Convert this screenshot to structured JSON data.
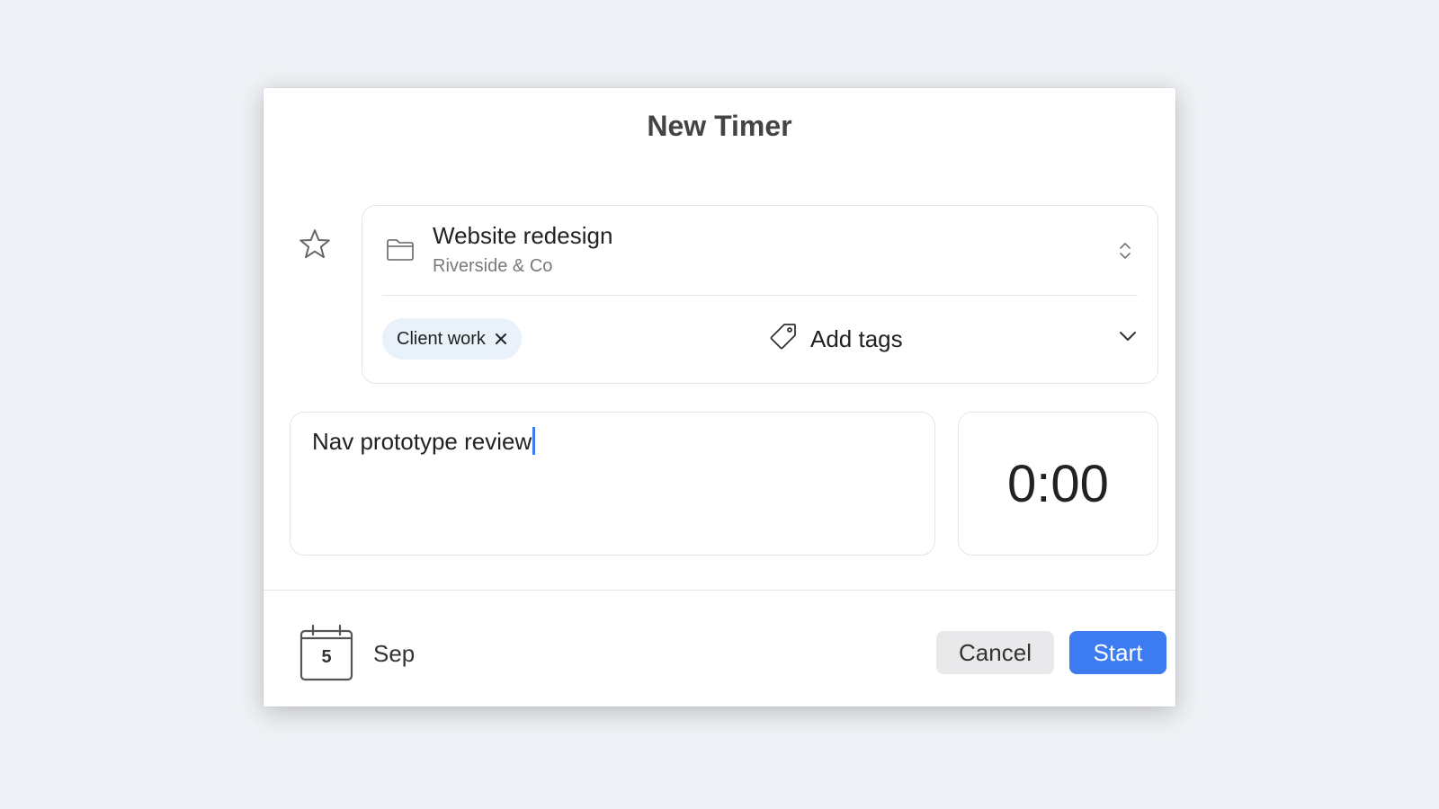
{
  "dialog": {
    "title": "New Timer"
  },
  "project": {
    "name": "Website redesign",
    "client": "Riverside & Co",
    "favorite_icon": "star-outline-icon",
    "folder_icon": "folder-icon",
    "picker_icon": "chevron-up-down-icon"
  },
  "tags": {
    "selected": [
      {
        "label": "Client work",
        "remove_icon": "close-x-icon"
      }
    ],
    "add_label": "Add tags",
    "tag_icon": "tag-icon",
    "dropdown_icon": "chevron-down-icon"
  },
  "notes": {
    "value": "Nav prototype review"
  },
  "timer": {
    "value": "0:00"
  },
  "date": {
    "day": "5",
    "month": "Sep",
    "icon": "calendar-icon"
  },
  "actions": {
    "cancel_label": "Cancel",
    "start_label": "Start"
  },
  "colors": {
    "accent": "#3d7cf0",
    "background": "#eef1f5",
    "tag_chip": "#e9f1fb",
    "cancel_button": "#e9e9eb"
  }
}
